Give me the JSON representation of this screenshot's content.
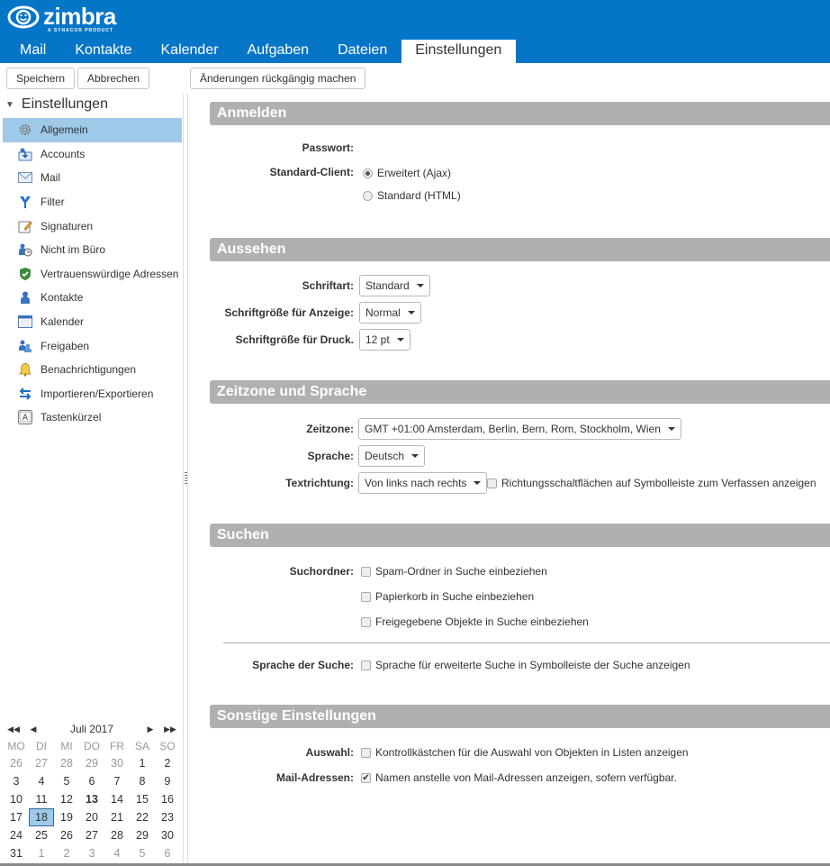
{
  "app": {
    "logo": "zimbra",
    "logo_sub": "A SYNACOR PRODUCT"
  },
  "tabs": [
    {
      "label": "Mail",
      "active": false
    },
    {
      "label": "Kontakte",
      "active": false
    },
    {
      "label": "Kalender",
      "active": false
    },
    {
      "label": "Aufgaben",
      "active": false
    },
    {
      "label": "Dateien",
      "active": false
    },
    {
      "label": "Einstellungen",
      "active": true
    }
  ],
  "toolbar": {
    "save": "Speichern",
    "cancel": "Abbrechen",
    "revert": "Änderungen rückgängig machen"
  },
  "sidebar": {
    "title": "Einstellungen",
    "items": [
      {
        "label": "Allgemein",
        "icon": "gear-icon",
        "selected": true
      },
      {
        "label": "Accounts",
        "icon": "accounts-icon"
      },
      {
        "label": "Mail",
        "icon": "envelope-icon"
      },
      {
        "label": "Filter",
        "icon": "filter-icon"
      },
      {
        "label": "Signaturen",
        "icon": "signature-icon"
      },
      {
        "label": "Nicht im Büro",
        "icon": "out-of-office-icon"
      },
      {
        "label": "Vertrauenswürdige Adressen",
        "icon": "shield-check-icon"
      },
      {
        "label": "Kontakte",
        "icon": "contact-icon"
      },
      {
        "label": "Kalender",
        "icon": "calendar-icon"
      },
      {
        "label": "Freigaben",
        "icon": "sharing-icon"
      },
      {
        "label": "Benachrichtigungen",
        "icon": "bell-icon"
      },
      {
        "label": "Importieren/Exportieren",
        "icon": "import-export-icon"
      },
      {
        "label": "Tastenkürzel",
        "icon": "keyboard-icon"
      }
    ]
  },
  "calendar": {
    "title": "Juli 2017",
    "dow": [
      "MO",
      "DI",
      "MI",
      "DO",
      "FR",
      "SA",
      "SO"
    ],
    "weeks": [
      [
        [
          "26",
          "other"
        ],
        [
          "27",
          "other"
        ],
        [
          "28",
          "other"
        ],
        [
          "29",
          "other"
        ],
        [
          "30",
          "other"
        ],
        [
          "1",
          ""
        ],
        [
          "2",
          ""
        ]
      ],
      [
        [
          "3",
          ""
        ],
        [
          "4",
          ""
        ],
        [
          "5",
          ""
        ],
        [
          "6",
          ""
        ],
        [
          "7",
          ""
        ],
        [
          "8",
          ""
        ],
        [
          "9",
          ""
        ]
      ],
      [
        [
          "10",
          ""
        ],
        [
          "11",
          ""
        ],
        [
          "12",
          ""
        ],
        [
          "13",
          "bold"
        ],
        [
          "14",
          ""
        ],
        [
          "15",
          ""
        ],
        [
          "16",
          ""
        ]
      ],
      [
        [
          "17",
          ""
        ],
        [
          "18",
          "sel"
        ],
        [
          "19",
          ""
        ],
        [
          "20",
          ""
        ],
        [
          "21",
          ""
        ],
        [
          "22",
          ""
        ],
        [
          "23",
          ""
        ]
      ],
      [
        [
          "24",
          ""
        ],
        [
          "25",
          ""
        ],
        [
          "26",
          ""
        ],
        [
          "27",
          ""
        ],
        [
          "28",
          ""
        ],
        [
          "29",
          ""
        ],
        [
          "30",
          ""
        ]
      ],
      [
        [
          "31",
          ""
        ],
        [
          "1",
          "other"
        ],
        [
          "2",
          "other"
        ],
        [
          "3",
          "other"
        ],
        [
          "4",
          "other"
        ],
        [
          "5",
          "other"
        ],
        [
          "6",
          "other"
        ]
      ]
    ]
  },
  "sections": {
    "login": {
      "title": "Anmelden",
      "password_label": "Passwort:",
      "client_label": "Standard-Client:",
      "client_options": [
        {
          "label": "Erweitert (Ajax)",
          "checked": true
        },
        {
          "label": "Standard (HTML)",
          "checked": false
        }
      ]
    },
    "appearance": {
      "title": "Aussehen",
      "font_label": "Schriftart:",
      "font_value": "Standard",
      "display_size_label": "Schriftgröße für Anzeige:",
      "display_size_value": "Normal",
      "print_size_label": "Schriftgröße für Druck.",
      "print_size_value": "12 pt"
    },
    "locale": {
      "title": "Zeitzone und Sprache",
      "tz_label": "Zeitzone:",
      "tz_value": "GMT +01:00 Amsterdam, Berlin, Bern, Rom, Stockholm, Wien",
      "lang_label": "Sprache:",
      "lang_value": "Deutsch",
      "dir_label": "Textrichtung:",
      "dir_value": "Von links nach rechts",
      "dir_checkbox": {
        "label": "Richtungsschaltflächen auf Symbolleiste zum Verfassen anzeigen",
        "checked": false
      }
    },
    "search": {
      "title": "Suchen",
      "folders_label": "Suchordner:",
      "folders": [
        {
          "label": "Spam-Ordner in Suche einbeziehen",
          "checked": false
        },
        {
          "label": "Papierkorb in Suche einbeziehen",
          "checked": false
        },
        {
          "label": "Freigegebene Objekte in Suche einbeziehen",
          "checked": false
        }
      ],
      "lang_label": "Sprache der Suche:",
      "lang_checkbox": {
        "label": "Sprache für erweiterte Suche in Symbolleiste der Suche anzeigen",
        "checked": false
      }
    },
    "other": {
      "title": "Sonstige Einstellungen",
      "select_label": "Auswahl:",
      "select_checkbox": {
        "label": "Kontrollkästchen für die Auswahl von Objekten in Listen anzeigen",
        "checked": false
      },
      "mail_label": "Mail-Adressen:",
      "mail_checkbox": {
        "label": "Namen anstelle von Mail-Adressen anzeigen, sofern verfügbar.",
        "checked": true
      }
    }
  }
}
